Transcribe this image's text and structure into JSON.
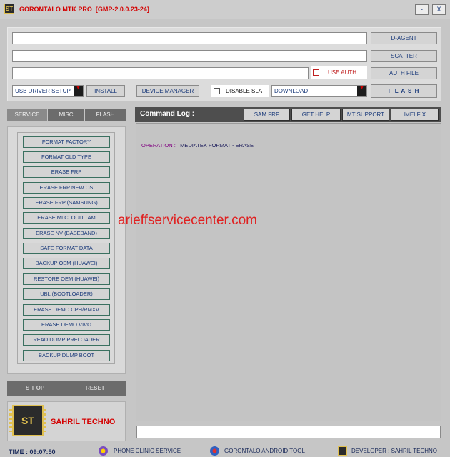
{
  "window": {
    "logo_text": "ST",
    "title": "GORONTALO MTK PRO  [GMP-2.0.0.23-24]",
    "minimize_label": "-",
    "close_label": "X"
  },
  "top": {
    "d_agent_label": "D-AGENT",
    "scatter_label": "SCATTER",
    "use_auth_label": "USE AUTH",
    "auth_file_label": "AUTH FILE",
    "driver_select": "USB DRIVER SETUP",
    "install_label": "INSTALL",
    "device_manager_label": "DEVICE MANAGER",
    "disable_sla_label": "DISABLE SLA",
    "mode_select": "DOWNLOAD",
    "flash_label": "F L A S H"
  },
  "tabs": [
    "SERVICE",
    "MISC",
    "FLASH"
  ],
  "service_buttons": [
    "FORMAT FACTORY",
    "FORMAT OLD TYPE",
    "ERASE FRP",
    "ERASE FRP NEW OS",
    "ERASE FRP (SAMSUNG)",
    "ERASE MI CLOUD TAM",
    "ERASE NV (BASEBAND)",
    "SAFE FORMAT DATA",
    "BACKUP OEM (HUAWEI)",
    "RESTORE OEM (HUAWEI)",
    "UBL (BOOTLOADER)",
    "ERASE DEMO CPH/RMXV",
    "ERASE DEMO VIVO",
    "READ DUMP PRELOADER",
    "BACKUP DUMP BOOT"
  ],
  "controls": {
    "stop_label": "S T OP",
    "reset_label": "RESET"
  },
  "brand": {
    "logo_text": "ST",
    "name": "SAHRIL TECHNO"
  },
  "log": {
    "title": "Command Log :",
    "tabs": [
      "SAM FRP",
      "GET HELP",
      "MT SUPPORT",
      "IMEI FIX"
    ],
    "op_label": "OPERATION :",
    "op_value": "MEDIATEK FORMAT - ERASE",
    "watermark": "arieffservicecenter.com",
    "progress_fraction": 0
  },
  "status": {
    "time_label": "TIME :",
    "time_value": "09:07:50",
    "phone_clinic": "PHONE CLINIC SERVICE",
    "android_tool": "GORONTALO ANDROID TOOL",
    "developer": "DEVELOPER : SAHRIL TECHNO"
  },
  "colors": {
    "title_red": "#d40000",
    "button_text": "#1a3a7a",
    "op_label": "#800080",
    "op_value": "#1a1a5a",
    "watermark": "#e02020",
    "tab_active": "#8a8a8a",
    "tab_inactive": "#6c6c6c"
  }
}
